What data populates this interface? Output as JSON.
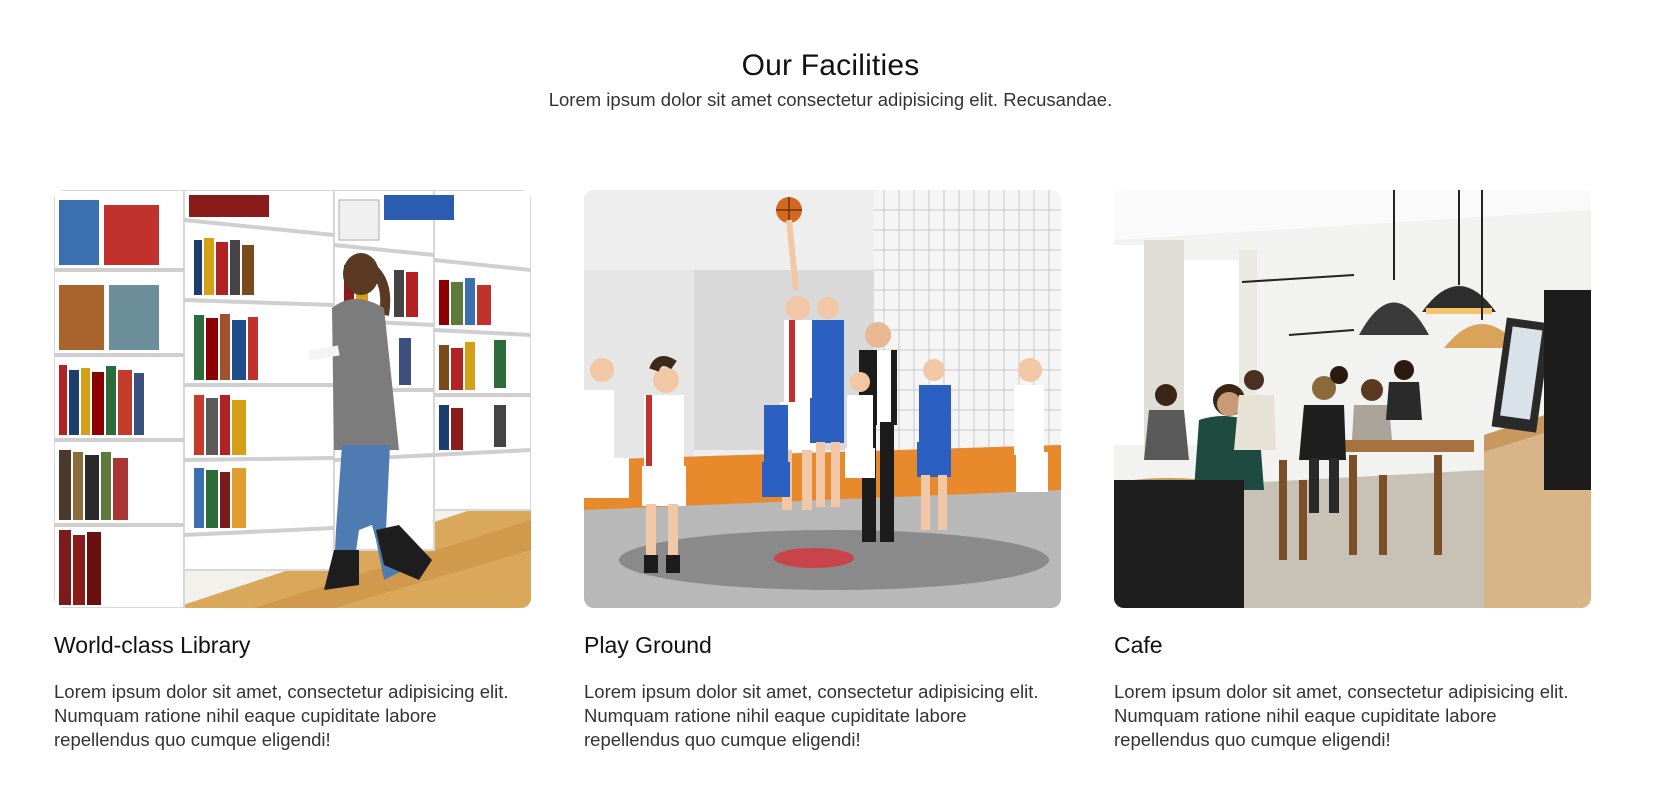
{
  "section": {
    "title": "Our Facilities",
    "subtitle": "Lorem ipsum dolor sit amet consectetur adipisicing elit. Recusandae."
  },
  "facilities": [
    {
      "title": "World-class Library",
      "description": "Lorem ipsum dolor sit amet, consectetur adipisicing elit. Numquam ratione nihil eaque cupiditate labore repellendus quo cumque eligendi!",
      "image": "library-photo"
    },
    {
      "title": "Play Ground",
      "description": "Lorem ipsum dolor sit amet, consectetur adipisicing elit. Numquam ratione nihil eaque cupiditate labore repellendus quo cumque eligendi!",
      "image": "basketball-photo"
    },
    {
      "title": "Cafe",
      "description": "Lorem ipsum dolor sit amet, consectetur adipisicing elit. Numquam ratione nihil eaque cupiditate labore repellendus quo cumque eligendi!",
      "image": "cafe-photo"
    }
  ]
}
